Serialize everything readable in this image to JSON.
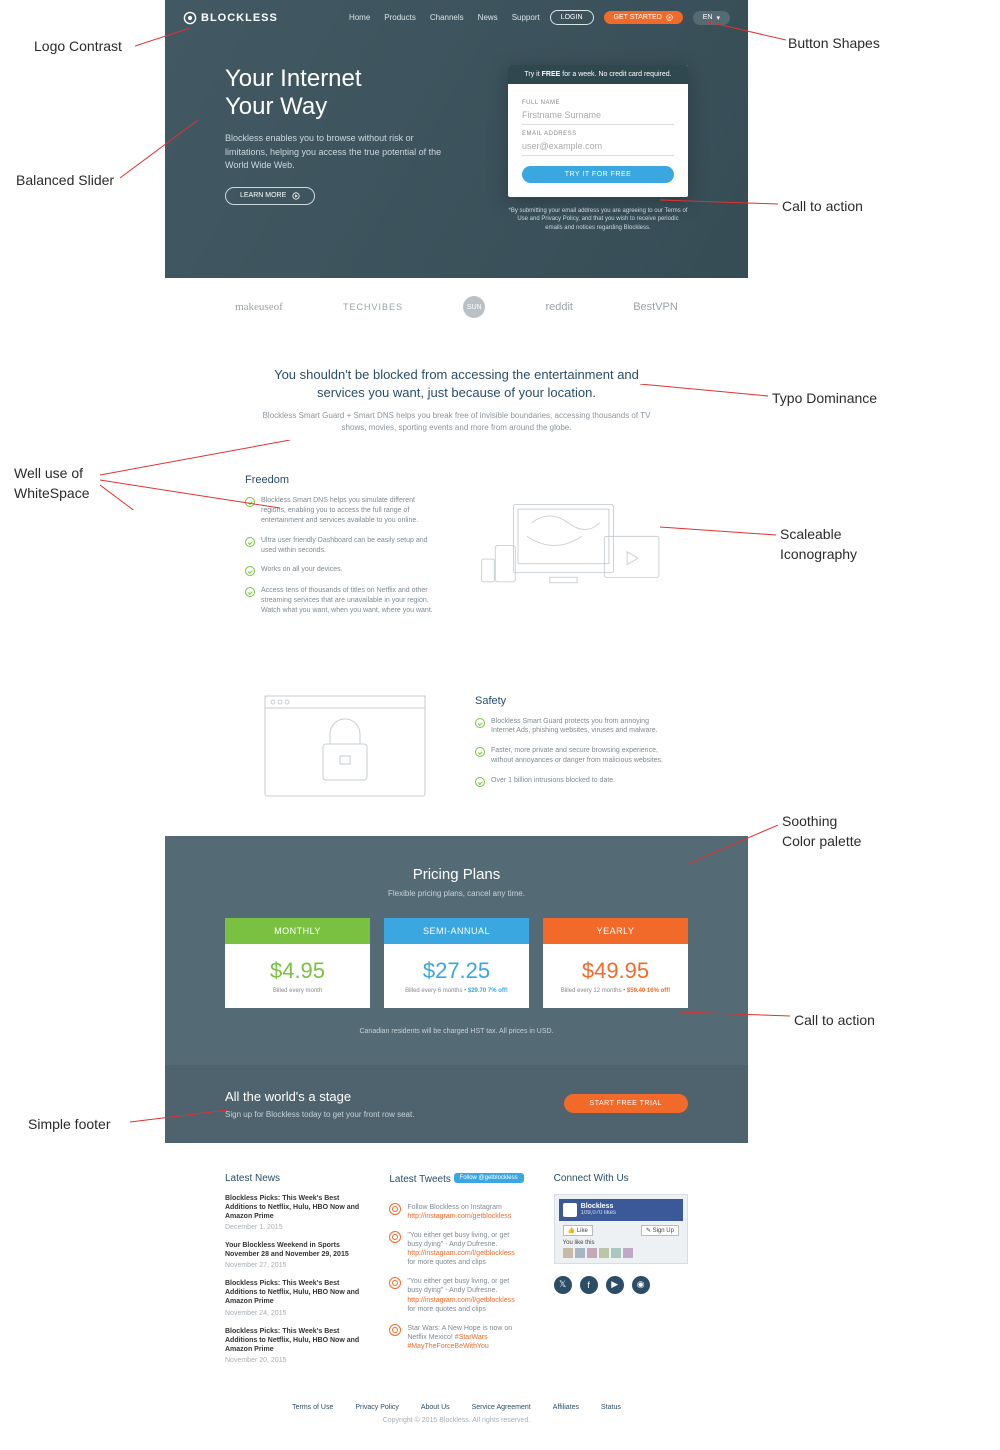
{
  "brand": "BLOCKLESS",
  "nav": {
    "items": [
      "Home",
      "Products",
      "Channels",
      "News",
      "Support"
    ],
    "login": "LOGIN",
    "cta": "GET STARTED",
    "lang": "EN"
  },
  "hero": {
    "title1": "Your Internet",
    "title2": "Your Way",
    "blurb": "Blockless enables you to browse without risk or limitations, helping you access the true potential of the World Wide Web.",
    "learn": "LEARN MORE"
  },
  "signup": {
    "bar_pre": "Try it ",
    "bar_b": "FREE",
    "bar_post": " for a week. No credit card required.",
    "full_label": "FULL NAME",
    "full_ph": "Firstname Surname",
    "email_label": "EMAIL ADDRESS",
    "email_ph": "user@example.com",
    "cta": "TRY IT FOR FREE",
    "fine": "*By submitting your email address you are agreeing to our Terms of Use and Privacy Policy, and that you wish to receive periodic emails and notices regarding Blockless."
  },
  "press": [
    "makeuseof",
    "TECHVIBES",
    "SUN",
    "reddit",
    "BestVPN"
  ],
  "intro": {
    "h": "You shouldn't be blocked from accessing the entertainment and services you want, just because of your location.",
    "p": "Blockless Smart Guard + Smart DNS helps you break free of invisible boundaries, accessing thousands of TV shows, movies, sporting events and more from around the globe."
  },
  "freedom": {
    "h": "Freedom",
    "items": [
      "Blockless Smart DNS helps you simulate different regions, enabling you to access the full range of entertainment and services available to you online.",
      "Ultra user friendly Dashboard can be easily setup and used within seconds.",
      "Works on all your devices.",
      "Access tens of thousands of titles on Netflix and other streaming services that are unavailable in your region. Watch what you want, when you want, where you want."
    ]
  },
  "safety": {
    "h": "Safety",
    "items": [
      "Blockless Smart Guard protects you from annoying Internet Ads, phishing websites, viruses and malware.",
      "Faster, more private and secure browsing experience, without annoyances or danger from malicious websites.",
      "Over 1 billion intrusions blocked to date."
    ]
  },
  "pricing": {
    "h": "Pricing Plans",
    "sub": "Flexible pricing plans, cancel any time.",
    "plans": [
      {
        "name": "MONTHLY",
        "price": "$4.95",
        "bill": "Billed every month",
        "off": ""
      },
      {
        "name": "SEMI-ANNUAL",
        "price": "$27.25",
        "bill": "Billed every 6 months • ",
        "off": "$29.70 7% off!"
      },
      {
        "name": "YEARLY",
        "price": "$49.95",
        "bill": "Billed every 12 months • ",
        "off": "$59.40 16% off!"
      }
    ],
    "note": "Canadian residents will be charged HST tax. All prices in USD."
  },
  "stage": {
    "h": "All the world's a stage",
    "p": "Sign up for Blockless today to get your front row seat.",
    "btn": "START FREE TRIAL"
  },
  "footer": {
    "news_h": "Latest News",
    "news": [
      {
        "t": "Blockless Picks: This Week's Best Additions to Netflix, Hulu, HBO Now and Amazon Prime",
        "d": "December 1, 2015"
      },
      {
        "t": "Your Blockless Weekend in Sports November 28 and November 29, 2015",
        "d": "November 27, 2015"
      },
      {
        "t": "Blockless Picks: This Week's Best Additions to Netflix, Hulu, HBO Now and Amazon Prime",
        "d": "November 24, 2015"
      },
      {
        "t": "Blockless Picks: This Week's Best Additions to Netflix, Hulu, HBO Now and Amazon Prime",
        "d": "November 20, 2015"
      }
    ],
    "tweets_h": "Latest Tweets",
    "follow": "Follow @getblockless",
    "tweets": [
      {
        "txt": "Follow Blockless on Instagram",
        "lnk": "http://instagram.com/getblockless"
      },
      {
        "txt": "\"You either get busy living, or get busy dying\" - Andy Dufresne.",
        "lnk": "http://instagram.com/l/getblockless",
        "suf": " for more quotes and clips"
      },
      {
        "txt": "\"You either get busy living, or get busy dying\" - Andy Dufresne.",
        "lnk": "http://instagram.com/l/getblockless",
        "suf": " for more quotes and clips"
      },
      {
        "txt": "Star Wars: A New Hope is now on Netflix Mexico! ",
        "lnk": "#StarWars #MayTheForceBeWithYou"
      }
    ],
    "connect_h": "Connect With Us",
    "fb_name": "Blockless",
    "fb_likes": "109,070 likes",
    "fb_like": "Like",
    "fb_signup": "Sign Up",
    "fb_you": "You like this"
  },
  "legal": {
    "links": [
      "Terms of Use",
      "Privacy Policy",
      "About Us",
      "Service Agreement",
      "Affiliates",
      "Status"
    ],
    "cp": "Copyright © 2015 Blockless. All rights reserved."
  },
  "ann": {
    "logo": "Logo Contrast",
    "slider": "Balanced Slider",
    "ws1": "Well use of",
    "ws2": "WhiteSpace",
    "footer": "Simple footer",
    "shapes": "Button Shapes",
    "cta": "Call to action",
    "typo": "Typo Dominance",
    "icon": "Scaleable",
    "icon2": "Iconography",
    "pal1": "Soothing",
    "pal2": "Color palette",
    "cta2": "Call to action"
  }
}
